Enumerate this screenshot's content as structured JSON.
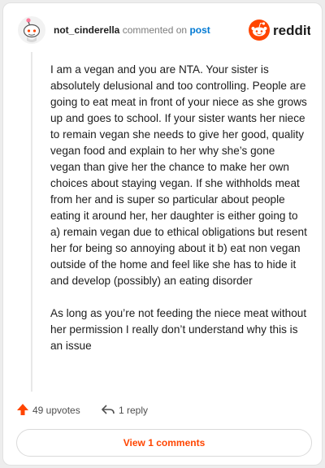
{
  "comment": {
    "username": "not_cinderella",
    "action_text": "commented on",
    "post_link_label": "post",
    "paragraphs": [
      "I am a vegan and you are NTA. Your sister is absolutely delusional and too controlling. People are going to eat meat in front of your niece as she grows up and goes to school. If your sister wants her niece to remain vegan she needs to give her good, quality vegan food and explain to her why she’s gone vegan than give her the chance to make her own choices about staying vegan. If she withholds meat from her and is super so particular about people eating it around her, her daughter is either going to a) remain vegan due to ethical obligations but resent her for being so annoying about it b) eat non vegan outside of the home and feel like she has to hide it and develop (possibly) an eating disorder",
      "As long as you’re not feeding the niece meat without her permission I really don’t understand why this is an issue"
    ]
  },
  "brand": {
    "name": "reddit",
    "accent": "#ff4500",
    "icon": "reddit-snoo-icon"
  },
  "actions": {
    "upvotes_label": "49 upvotes",
    "upvote_icon": "upvote-arrow-icon",
    "upvote_color": "#ff4500",
    "replies_label": "1 reply",
    "reply_icon": "reply-arrow-icon"
  },
  "footer": {
    "view_comments_label": "View 1 comments"
  },
  "colors": {
    "link": "#0079d3",
    "muted": "#7c7c7c",
    "thread_line": "#e8e8e8"
  }
}
